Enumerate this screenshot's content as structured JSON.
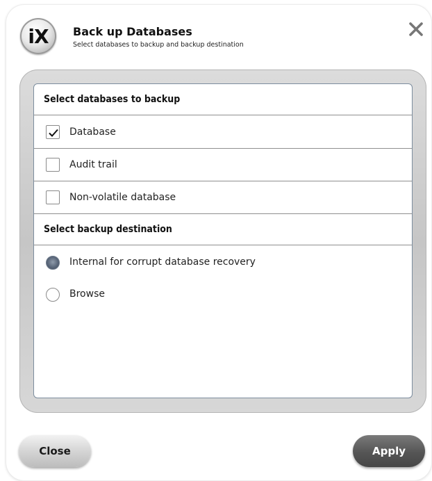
{
  "dialog": {
    "logo_text": "iX",
    "title": "Back up Databases",
    "subtitle": "Select databases to backup and backup destination"
  },
  "databases": {
    "header": "Select databases to backup",
    "items": [
      {
        "label": "Database",
        "checked": true
      },
      {
        "label": "Audit trail",
        "checked": false
      },
      {
        "label": "Non-volatile database",
        "checked": false
      }
    ]
  },
  "destination": {
    "header": "Select backup destination",
    "options": [
      {
        "label": "Internal for corrupt database recovery",
        "selected": true
      },
      {
        "label": "Browse",
        "selected": false
      }
    ]
  },
  "footer": {
    "close_label": "Close",
    "apply_label": "Apply"
  },
  "icons": {
    "logo": "ix-logo-icon",
    "close": "close-icon",
    "check": "checkmark-icon"
  }
}
